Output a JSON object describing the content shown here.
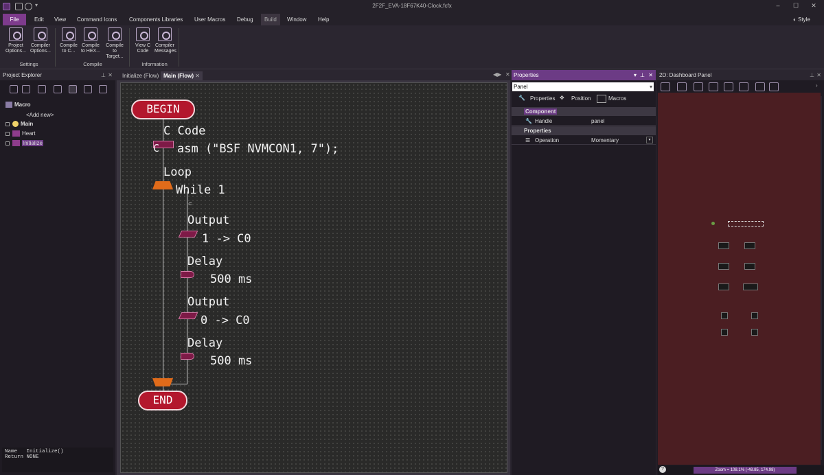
{
  "window": {
    "title": "2F2F_EVA-18F67K40-Clock.fcfx",
    "controls": [
      "minimize-icon",
      "maximize-icon",
      "close-icon"
    ],
    "style_label": "Style"
  },
  "menu": {
    "items": [
      "File",
      "Edit",
      "View",
      "Command Icons",
      "Components Libraries",
      "User Macros",
      "Debug",
      "Build",
      "Window",
      "Help"
    ]
  },
  "ribbon": {
    "buttons": [
      {
        "label": "Project\nOptions...",
        "icon": "gear-icon"
      },
      {
        "label": "Compiler\nOptions...",
        "icon": "gears-icon"
      },
      {
        "label": "Compile\nto C...",
        "icon": "c-file-icon"
      },
      {
        "label": "Compile\nto HEX...",
        "icon": "binary-icon"
      },
      {
        "label": "Compile\nto Target...",
        "icon": "chip-icon"
      },
      {
        "label": "View C\nCode",
        "icon": "view-code-icon"
      },
      {
        "label": "Compiler\nMessages",
        "icon": "messages-icon"
      }
    ],
    "groups": [
      "Settings",
      "Compile",
      "Information"
    ]
  },
  "project_explorer": {
    "title": "Project Explorer",
    "tree": {
      "root": "Macro",
      "add_new": "<Add new>",
      "items": [
        "Main",
        "Heart",
        "Initialize"
      ]
    },
    "info": {
      "name_label": "Name",
      "name_value": "Initialize()",
      "return_label": "Return",
      "return_value": "NONE"
    }
  },
  "tabs": [
    "Initialize (Flow)",
    "Main (Flow)"
  ],
  "flowchart": {
    "begin": "BEGIN",
    "end": "END",
    "ccode_title": "C Code",
    "ccode_body": "asm (\"BSF NVMCON1, 7\");",
    "ccode_icon_label": "C",
    "loop_title": "Loop",
    "loop_cond": "While 1",
    "steps": [
      {
        "title": "Output",
        "body": "1 -> C0"
      },
      {
        "title": "Delay",
        "body": "500 ms"
      },
      {
        "title": "Output",
        "body": "0 -> C0"
      },
      {
        "title": "Delay",
        "body": "500 ms"
      }
    ]
  },
  "properties": {
    "title": "Properties",
    "selected": "Panel",
    "tabs": [
      "Properties",
      "Position",
      "Macros"
    ],
    "groups": [
      {
        "name": "Component",
        "rows": [
          {
            "key": "Handle",
            "value": "panel"
          }
        ]
      },
      {
        "name": "Properties",
        "rows": [
          {
            "key": "Operation",
            "value": "Momentary"
          }
        ]
      }
    ]
  },
  "dashboard": {
    "title": "2D: Dashboard Panel",
    "zoom_text": "Zoom = 108.1% (-48.85, 174.98)"
  }
}
